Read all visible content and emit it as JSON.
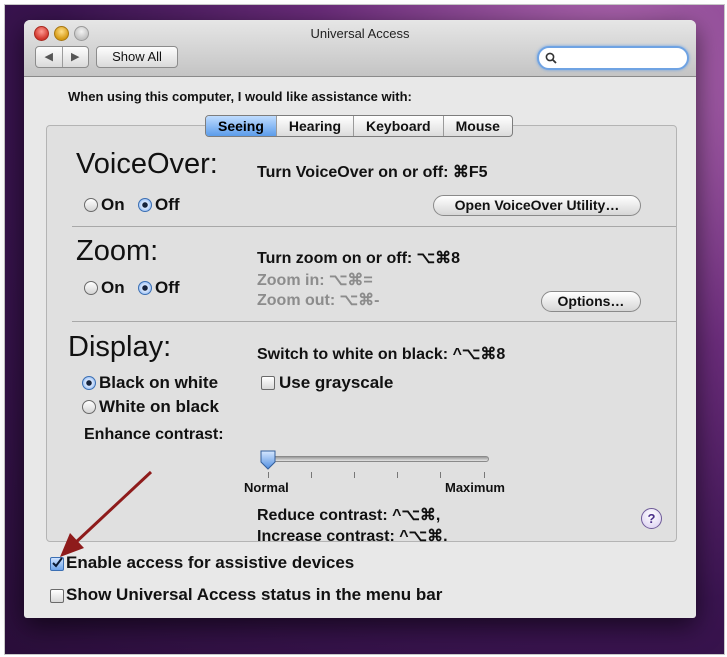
{
  "window": {
    "title": "Universal Access",
    "nav_back": "◀",
    "nav_forward": "▶",
    "show_all_label": "Show All",
    "search_placeholder": ""
  },
  "heading": "When using this computer, I would like assistance with:",
  "tabs": [
    {
      "label": "Seeing",
      "active": true
    },
    {
      "label": "Hearing",
      "active": false
    },
    {
      "label": "Keyboard",
      "active": false
    },
    {
      "label": "Mouse",
      "active": false
    }
  ],
  "voiceover": {
    "title": "VoiceOver:",
    "shortcut": "Turn VoiceOver on or off: ⌘F5",
    "on_label": "On",
    "off_label": "Off",
    "selected": "Off",
    "utility_button": "Open VoiceOver Utility…"
  },
  "zoom": {
    "title": "Zoom:",
    "shortcut": "Turn zoom on or off: ⌥⌘8",
    "zoom_in": "Zoom in: ⌥⌘=",
    "zoom_out": "Zoom out: ⌥⌘-",
    "on_label": "On",
    "off_label": "Off",
    "selected": "Off",
    "options_button": "Options…"
  },
  "display": {
    "title": "Display:",
    "shortcut": "Switch to white on black: ^⌥⌘8",
    "black_on_white": "Black on white",
    "white_on_black": "White on black",
    "selected": "Black on white",
    "grayscale_label": "Use grayscale",
    "grayscale_checked": false,
    "contrast_label": "Enhance contrast:",
    "contrast_min": "Normal",
    "contrast_max": "Maximum",
    "contrast_value": 0,
    "reduce_contrast": "Reduce contrast: ^⌥⌘,",
    "increase_contrast": "Increase contrast: ^⌥⌘.",
    "help": "?"
  },
  "footer": {
    "assistive_label": "Enable access for assistive devices",
    "assistive_checked": true,
    "status_label": "Show Universal Access status in the menu bar",
    "status_checked": false
  },
  "colors": {
    "accent": "#5c9cea",
    "arrow": "#8e1b1b"
  }
}
